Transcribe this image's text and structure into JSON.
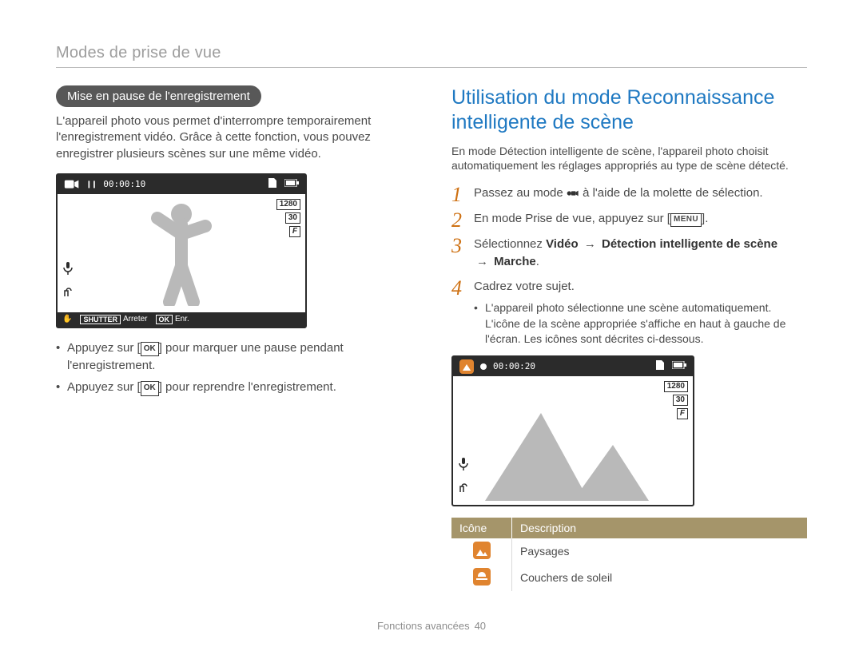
{
  "breadcrumb": "Modes de prise de vue",
  "left": {
    "pill_title": "Mise en pause de l'enregistrement",
    "intro": "L'appareil photo vous permet d'interrompre temporairement l'enregistrement vidéo. Grâce à cette fonction, vous pouvez enregistrer plusieurs scènes sur une même vidéo.",
    "lcd": {
      "pause_glyph": "❙❙",
      "timer": "00:00:10",
      "res": "1280",
      "fps": "30",
      "aperture": "F",
      "bottom_shutter": "SHUTTER",
      "bottom_arreter": "Arreter",
      "bottom_ok": "OK",
      "bottom_enr": "Enr."
    },
    "bullets": {
      "b1_pre": "Appuyez sur [",
      "ok_label": "OK",
      "b1_post": "] pour marquer une pause pendant l'enregistrement.",
      "b2_pre": "Appuyez sur [",
      "b2_post": "] pour reprendre l'enregistrement."
    }
  },
  "right": {
    "heading": "Utilisation du mode Reconnaissance intelligente de scène",
    "intro": "En mode Détection intelligente de scène, l'appareil photo choisit automatiquement les réglages appropriés au type de scène détecté.",
    "steps": {
      "s1_pre": "Passez au mode ",
      "s1_post": " à l'aide de la molette de sélection.",
      "s2_pre": "En mode Prise de vue, appuyez sur [",
      "menu_label": "MENU",
      "s2_post": "].",
      "s3_pre": "Sélectionnez ",
      "s3_video": "Vidéo",
      "s3_arrow": "→",
      "s3_detect": "Détection intelligente de scène",
      "s3_marche": "Marche",
      "s3_period": ".",
      "s4": "Cadrez votre sujet.",
      "s4_sub": "L'appareil photo sélectionne une scène automatiquement. L'icône de la scène appropriée s'affiche en haut à gauche de l'écran. Les icônes sont décrites ci-dessous."
    },
    "lcd": {
      "timer": "00:00:20",
      "res": "1280",
      "fps": "30",
      "aperture": "F"
    },
    "table": {
      "h1": "Icône",
      "h2": "Description",
      "r1": "Paysages",
      "r2": "Couchers de soleil"
    }
  },
  "footer": {
    "label": "Fonctions avancées",
    "page": "40"
  }
}
